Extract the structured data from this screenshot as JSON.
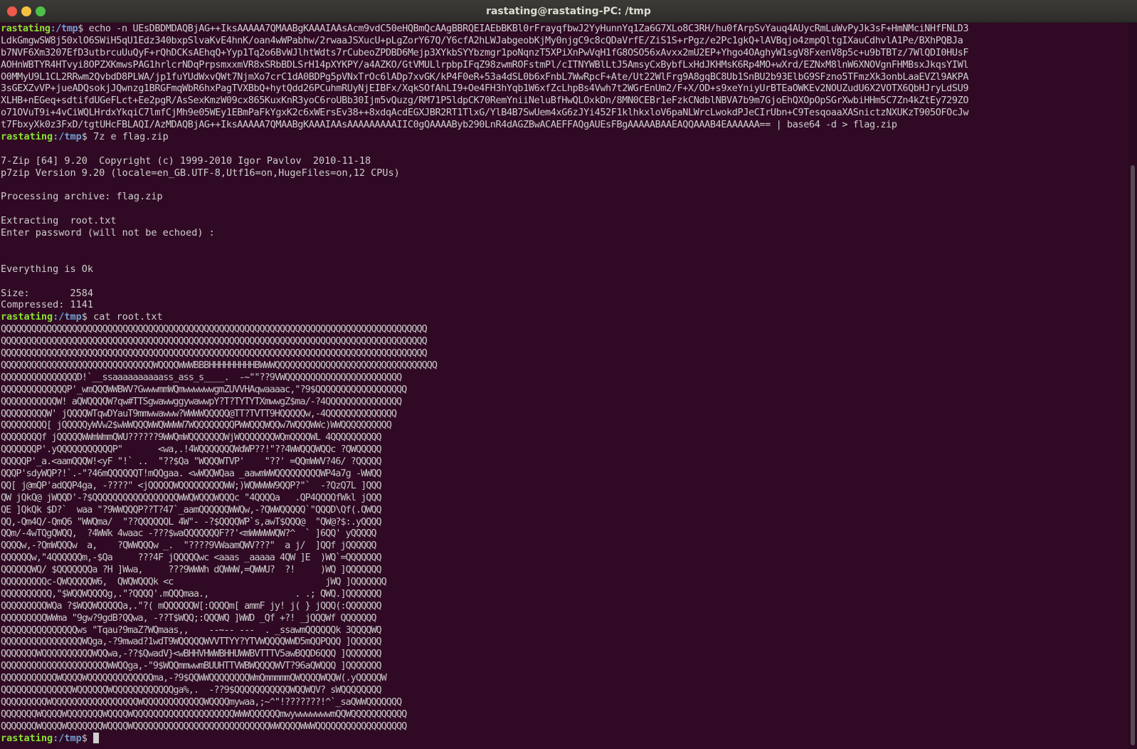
{
  "window": {
    "title": "rastating@rastating-PC: /tmp"
  },
  "prompt": {
    "user": "rastating",
    "path": ":/tmp",
    "symbol": "$"
  },
  "commands": {
    "echo_cmd": " echo -n UEsDBDMDAQBjAG++IksAAAAA7QMAABgKAAAIAAsAcm9vdC50eHQBmQcAAgBBRQEIAEbBKBl0rFrayqfbwJ2YyHunnYq1Za6G7XLo8C3RH/hu0fArpSvYauq4AUycRmLuWvPyJk3sF+HmNMciNHfFNLD3",
    "cmd_7z": " 7z e flag.zip",
    "cmd_cat": " cat root.txt"
  },
  "echo_wraps": [
    "LdkGmgwSW8j50xlO6SWiH5qU1Edz340bxpSlvaKvE4hnK/oan4wWPabhw/2rwaaJSXucU+pLgZorY67Q/Y6cfA2hLWJabgeobKjMy0njgC9c8cQDaVrfE/ZiS1S+rPgz/e2Pc1gkQ+lAVBqjo4zmpQltgIXauCdhvlA1Pe/BXhPQBJa",
    "b7NVF6Xm3207EfD3utbrcuUuQyF+rQhDCKsAEhqQ+Yyp1Tq2o6BvWJlhtWdts7rCubeoZPDBD6Mejp3XYkbSYYbzmgr1poNqnzT5XPiXnPwVqH1fG8OSO56xAvxx2mU2EP+Yhgo4OAghyW1sgV8FxenV8p5c+u9bTBTz/7WlQDI0HUsF",
    "AOHnWBTYR4HTvyi8OPZXKmwsPAG1hrlcrNDqPrpsmxxmVR8xSRbBDLSrH14pXYKPY/a4AZKO/GtVMULlrpbpIFqZ98zwmROFstmPl/cITNYWBlLtJ5AmsyCxBybfLxHdJKHMsK6Rp4MO+wXrd/EZNxM8lnW6XNOVgnFHMBsxJkqsYIWl",
    "O0MMyU9L1CL2RRwm2QvbdD8PLWA/jp1fuYUdWxvQWt7NjmXo7crC1dA0BDPg5pVNxTrOc6lADp7xvGK/kP4F0eR+53a4dSL0b6xFnbL7WwRpcF+Ate/Ut22WlFrg9A8gqBC8Ub1SnBU2b93ElbG9SFzno5TFmzXk3onbLaaEVZl9AKPA",
    "3sGEXZvVP+jueADQsokjJQwnzg1BRGFmqWbR6hxPagTVXBbQ+hytQdd26PCuhmRUyNjEIBFx/XqkSOfAhLI9+Oe4FH3hYqb1W6xfZcLhpBs4Vwh7t2WGrEnUm2/F+X/OD+s9xeYniyUrBTEaOWKEv2NOUZudU6X2VOTX6QbHJryLdSU9",
    "XLHB+nEGeq+sdtifdUGeFLct+Ee2pgR/AsSexKmzW09cx865KuxKnR3yoC6roUBb30Ijm5vQuzg/RM71P5ldpCK70RemYniiNeluBfHwQLOxkDn/8MN0CEBr1eFzkCNdblNBVA7b9m7GjoEhQXOpOpSGrXwbiHHm5C7Zn4kZtEy729ZO",
    "o71OVuT9i+4vCiWQLHrdxYkqiC7lmfCjMh9e05WEy1EBmPaFkYgxK2c6xWErsEv38++8xdqAcdEGXJBR2RT1TlxG/YlB4B7SwUem4xG6zJYi452F1klhkxloV6paNLWrcLwokdPJeCIrUbn+C9TesqoaaXASnictzNXUKzT905OFOcJw",
    "t7FbxyXk0z3FxD/tgtUHcFBLAQI/AzMDAQBjAG++IksAAAAA7QMAABgKAAAIAAsAAAAAAAAAIIC0gQAAAAByb290LnR4dAGZBwACAEFFAQgAUEsFBgAAAAABAAEAQQAAAB4EAAAAAA== | base64 -d > flag.zip"
  ],
  "output_7z": [
    "",
    "7-Zip [64] 9.20  Copyright (c) 1999-2010 Igor Pavlov  2010-11-18",
    "p7zip Version 9.20 (locale=en_GB.UTF-8,Utf16=on,HugeFiles=on,12 CPUs)",
    "",
    "Processing archive: flag.zip",
    "",
    "Extracting  root.txt",
    "Enter password (will not be echoed) :",
    "",
    "",
    "Everything is Ok",
    "",
    "Size:       2584",
    "Compressed: 1141"
  ],
  "ascii_art": [
    "QQQQQQQQQQQQQQQQQQQQQQQQQQQQQQQQQQQQQQQQQQQQQQQQQQQQQQQQQQQQQQQQQQQQQQQQQQQQQQQQQQQQ",
    "QQQQQQQQQQQQQQQQQQQQQQQQQQQQQQQQQQQQQQQQQQQQQQQQQQQQQQQQQQQQQQQQQQQQQQQQQQQQQQQQQQQQ",
    "QQQQQQQQQQQQQQQQQQQQQQQQQQQQQQQQQQQQQQQQQQQQQQQQQQQQQQQQQQQQQQQQQQQQQQQQQQQQQQQQQQQQ",
    "QQQQQQQQQQQQQQQQQQQQQQQQQQQQQQWQQQQWWWBBBHHHHHHHHHBWWWQQQQQQQQQQQQQQQQQQQQQQQQQQQQQQQQ",
    "QQQQQQQQQQQQQQQD!`__ssaaaaaaaaaass_ass_s____.  -~\"\"??9VWQQQQQQQQQQQQQQQQQQQQQQQ",
    "QQQQQQQQQQQQQP'_wmQQQWWBWV?GwwwmmWQmwwwwwwgmZUVVHAqwaaaac,\"?9$QQQQQQQQQQQQQQQQQQ",
    "QQQQQQQQQQQW! aQWQQQQW?qw#TTSgwawwggywawwpY?T?TYTYTXmwwgZ$ma/-?4QQQQQQQQQQQQQQQ",
    "QQQQQQQQQW' jQQQQWTqwDYauT9mmwwawww?WWWWQQQQQ@TT?TVTT9HQQQQQw,-4QQQQQQQQQQQQQQ",
    "QQQQQQQQQ[ jQQQQQyWVw2$wWWQQQWWQWWWW7WQQQQQQQQPWWQQQWQQw7WQQQWWc)WWQQQQQQQQQQ",
    "QQQQQQQQf jQQQQQWWmWmmQWU??????9WWQmWQQQQQQQWjWQQQQQQQWQmQQQQWL 4QQQQQQQQQQ",
    "QQQQQQQP'.yQQQQQQQQQQQP\"       <wa,.!4WQQQQQQQWdWP??!\"??4WWQQQWQQc ?QWQQQQQ",
    "QQQQQP'_a.<aamQQQW!<yF \"!` ..  \"??$Qa \"WQQQWTVP'    \"??' =QQmWWV?46/ ?QQQQQ",
    "QQQP'sdyWQP?!`.-\"?46mQQQQQQT!mQQgaa. <wWQQWQaa _aawmWWQQQQQQQQQWP4a7g -WWQQ",
    "QQ[ j@mQP'adQQP4ga, -????\" <jQQQQQWQQQQQQQQQWW;)WQWWWW9QQP?\"`  -?QzQ7L ]QQQ",
    "QW jQkQ@ jWQQD'-?$QQQQQQQQQQQQQQQQQWWQWQQQWQQQc \"4QQQQa   .QP4QQQQfWkl jQQQ",
    "QE ]QkQk $D?`  waa \"?9WWQQQP??T?47`_aamQQQQQQWWQw,-?QWWQQQQQ`\"QQQD\\Qf(.QWQQ",
    "QQ,-Qm4Q/-QmQ6 \"WWQma/  \"??QQQQQQL 4W\"- -?$QQQQWP`s,awT$QQQ@  \"QW@?$:.yQQQQ",
    "QQm/-4wTQgQWQQ,  ?4WWk 4waac -???$waQQQQQQQF??'<mWWWWWQW?^  ` ]6QQ' yQQQQQ",
    "QQQQw,-?QmWQQQw  a,    ?QWWQQQw _.  \"????9VWaamQWV???\"  a j/  ]QQf jQQQQQQ",
    "QQQQQQw,\"4QQQQQQm,-$Qa     ???4F jQQQQQwc <aaas _aaaaa 4QW ]E  )WQ`=QQQQQQQ",
    "QQQQQQWQ/ $QQQQQQQa ?H ]Wwa,     ???9WWWh dQWWW,=QWWU?  ?!     )WQ ]QQQQQQQ",
    "QQQQQQQQQc-QWQQQQQW6,  QWQWQQQk <c                              jWQ ]QQQQQQQ",
    "QQQQQQQQQQ,\"$WQQWQQQQg,.\"?QQQQ'.mQQQmaa.,                 . .; QWQ.]QQQQQQQ",
    "QQQQQQQQQWQa ?$WQQWQQQQQa,.\"?( mQQQQQQW[:QQQQm[ ammF jy! j( } jQQQ(:QQQQQQQ",
    "QQQQQQQQQWWma \"9gw?9gdB?QQwa, -??T$WQQ;:QQQWQ ]WWD _Qf +?! _jQQQWf QQQQQQQ",
    "QQQQQQQQQQQQQQQws \"Tqau?9maZ?WQmaas,,    --~-- ---  . _ssawmQQQQQQk 3QQQQWQ",
    "QQQQQQQQQQQQQQQQWQga,-?9mwad?1wdT9WQQQQQWVVTTYY?YTVWQQQQWWD5mQQPQQQ ]QQQQQQ",
    "QQQQQQQWQQQQQQQQQQWQQwa,-??$QwadV}<wBHHVHWWBHHUWWBVTTTV5awBQQD6QQQ ]QQQQQQQ",
    "QQQQQQQQQQQQQQQQQQQQQWWQQga,-\"9$WQQmmwwmBUUHTTVWBWQQQQWVT?96aQWQQQ ]QQQQQQQ",
    "QQQQQQQQQQQWQQQQWQQQQQQQQQQQQQma,-?9$QQWWQQQQQQQQWmQmmmmmQWQQQQWQQW(.yQQQQQW",
    "QQQQQQQQQQQQQQWQQQQQQWQQQQQQQQQQQQga%,.  -??9$QQQQQQQQQQQWQQWQV? sWQQQQQQQQ",
    "QQQQQQQQQWQQQQQQQQQQQQQQQQQWQQQQQQQQQQQQWQQQQmywaa,;~^\"!???????!^`_saQWWQQQQQQQ",
    "QQQQQQQWQQQQWQQQQQQQWQQQQWQQQQQQQQQQQQQQQQQQQQWWWQQQQQQmwywwwwwwwmQQWQQQQQQQQQQQ",
    "QQQQQQQWQQQQWQQQQQQQWQQQQWQQQQQQQQQQQQQQQQQQQQQQQQQQQWWQQQQWWWQQQQQQQQQQQQQQQQQQ"
  ]
}
